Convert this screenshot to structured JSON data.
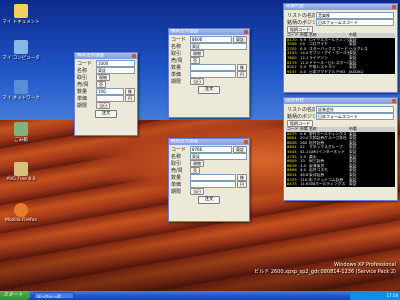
{
  "desktop": {
    "icons": [
      {
        "label": "マイ ドキュメント",
        "color": "#f2d15a"
      },
      {
        "label": "マイ コンピュータ",
        "color": "#8ab6e8"
      },
      {
        "label": "マイ ネットワーク",
        "color": "#5a8fd8"
      },
      {
        "label": "ごみ箱",
        "color": "#7fb47f"
      },
      {
        "label": "AVG Free 8.0",
        "color": "#d9c07a"
      },
      {
        "label": "Mozilla Firefox",
        "color": "#e87a2a"
      }
    ]
  },
  "windows": {
    "a": {
      "title": "株式注文画面",
      "rows": [
        {
          "label": "コード",
          "value": "1000",
          "btn": ""
        },
        {
          "label": "名称",
          "value": "東証",
          "btn": ""
        },
        {
          "label": "取引",
          "value": "",
          "btn": "現物"
        },
        {
          "label": "売/買",
          "value": "",
          "btn": "売"
        },
        {
          "label": "数量",
          "value": "100",
          "btn": "株"
        },
        {
          "label": "単価",
          "value": "",
          "btn": "円"
        },
        {
          "label": "期限",
          "value": "",
          "btn": "当日"
        }
      ],
      "go": "注文"
    },
    "b": {
      "title": "株式注文画面",
      "rows": [
        {
          "label": "コード",
          "value": "8606",
          "btn": "東証"
        },
        {
          "label": "名称",
          "value": "東証",
          "btn": ""
        },
        {
          "label": "取引",
          "value": "",
          "btn": "現物"
        },
        {
          "label": "売/買",
          "value": "",
          "btn": "売"
        },
        {
          "label": "数量",
          "value": "",
          "btn": "株"
        },
        {
          "label": "単価",
          "value": "",
          "btn": "円"
        },
        {
          "label": "期限",
          "value": "",
          "btn": "当日"
        }
      ],
      "go": "注文"
    },
    "c": {
      "title": "株式注文画面",
      "rows": [
        {
          "label": "コード",
          "value": "8766",
          "btn": "東証"
        },
        {
          "label": "名称",
          "value": "東証",
          "btn": ""
        },
        {
          "label": "取引",
          "value": "",
          "btn": "現物"
        },
        {
          "label": "売/買",
          "value": "",
          "btn": "売"
        },
        {
          "label": "数量",
          "value": "",
          "btn": "株"
        },
        {
          "label": "単価",
          "value": "",
          "btn": "円"
        },
        {
          "label": "期限",
          "value": "",
          "btn": "当日"
        }
      ],
      "go": "注文"
    },
    "list1": {
      "title": "売買代金",
      "field1_label": "リストの名前",
      "field1_value": "音楽株",
      "field2_label": "銘柄のポジション",
      "field2_value": "日本フォームスコード",
      "btn": "銘柄コード",
      "columns": [
        "コード",
        "市場",
        "名称",
        "市場"
      ],
      "rows": [
        [
          "8170",
          "9.9",
          "ロイヤルホールディングス",
          "東証"
        ],
        [
          "3506",
          "C5",
          "コロワイド",
          "東証"
        ],
        [
          "2702",
          "0.0",
          "スターバックス コーヒー",
          "ヘラクレス"
        ],
        [
          "3153",
          "14.0",
          "セブン・アイ・ホールディ",
          "東証"
        ],
        [
          "7600",
          "12.1",
          "ライドソン",
          "東証"
        ],
        [
          "8179",
          "11.0",
          "ドトール・日レスホールディ",
          "東証"
        ],
        [
          "8007",
          "2.0",
          "牛角レストラン",
          "東証"
        ],
        [
          "9437",
          "0.0",
          "日本マクドナルドHD",
          "JASDAQ"
        ]
      ]
    },
    "list2": {
      "title": "証券会社",
      "field1_label": "リストの名前",
      "field1_value": "証券会社",
      "field2_label": "銘柄のポジション",
      "field2_value": "日本フォームスコード",
      "btn": "銘柄コード",
      "columns": [
        "コード",
        "市場",
        "名称",
        "市場"
      ],
      "rows": [
        [
          "8473",
          "0.6",
          "野村ホールディングス",
          "東証"
        ],
        [
          "8601",
          "20.0",
          "大和証券グループ本社",
          "東証"
        ],
        [
          "8628",
          "260",
          "松井証券",
          "東証"
        ],
        [
          "8604",
          "22",
          "マネックスグループ",
          "東証"
        ],
        [
          "3445",
          "41.1",
          "GMOインターネット",
          "東証"
        ],
        [
          "4755",
          "2.0",
          "楽天",
          "東証"
        ],
        [
          "8609",
          "13",
          "岡三証券",
          "東証"
        ],
        [
          "8616",
          "3.0",
          "東海東京",
          "東証"
        ],
        [
          "8698",
          "4.0",
          "岩井コスモ",
          "東証"
        ],
        [
          "8614",
          "46.6",
          "東洋証券",
          "東証"
        ],
        [
          "8703",
          "110.0",
          "カブドットコム証券",
          "東証"
        ],
        [
          "8473",
          "11.6",
          "SBIホールディングス",
          "東証"
        ]
      ]
    }
  },
  "taskbar": {
    "start": "スタート",
    "task": "ほっちゃっ君",
    "clock": "17:58"
  },
  "watermark": {
    "line1": "Windows XP Professional",
    "line2": "ビルド 2600.xpsp_sp2_gdr.080814-1236 (Service Pack 2)"
  }
}
